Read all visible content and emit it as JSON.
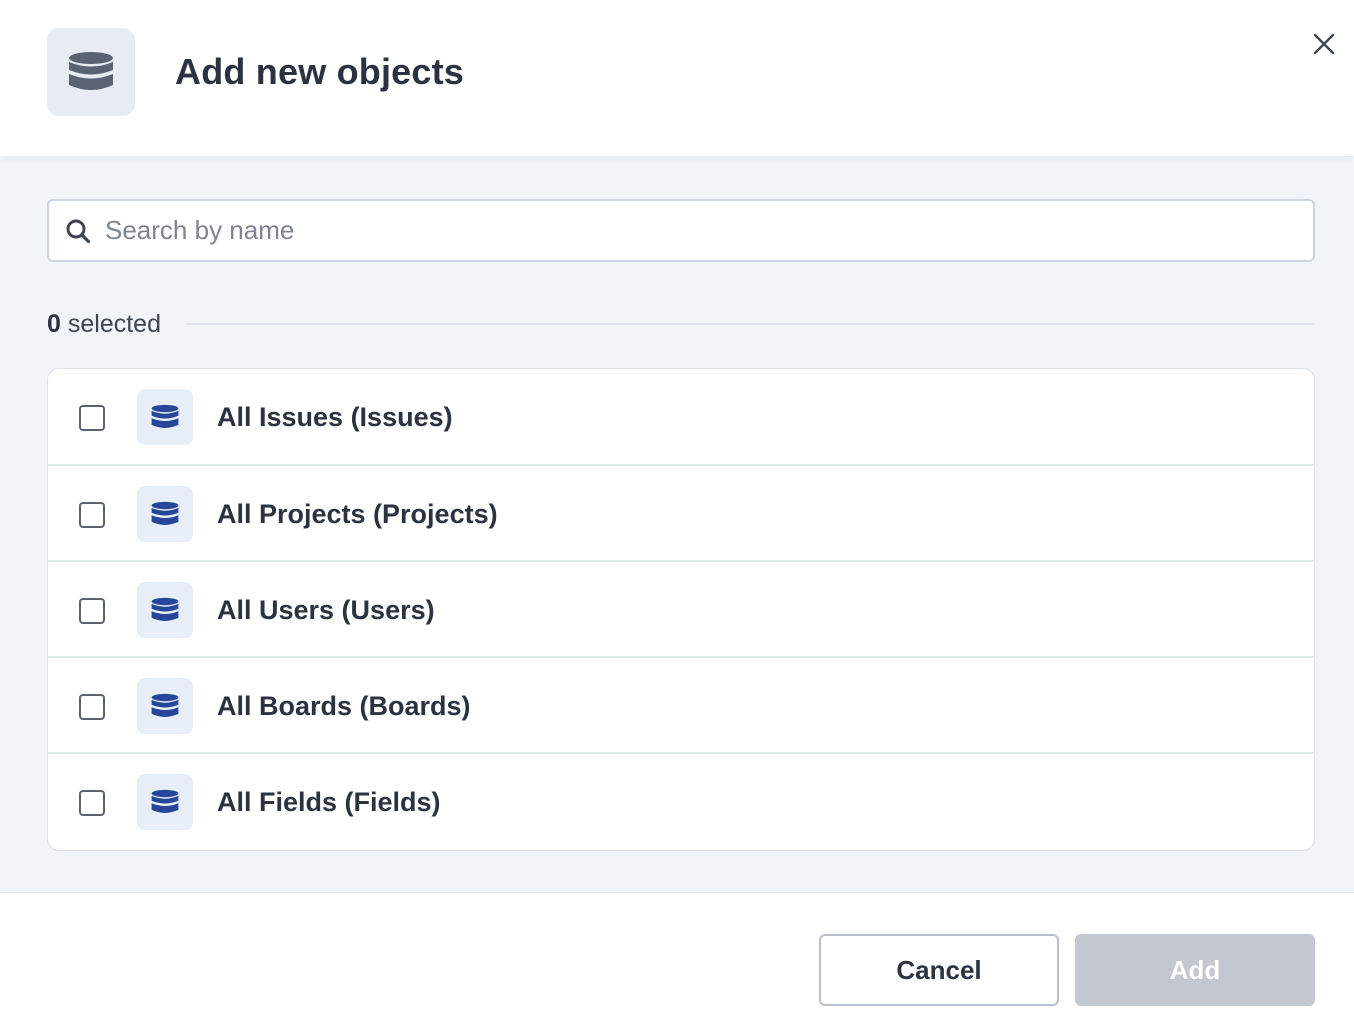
{
  "dialog": {
    "title": "Add new objects",
    "header_icon": "database-icon",
    "close_icon": "close-icon"
  },
  "search": {
    "placeholder": "Search by name",
    "value": "",
    "icon": "search-icon"
  },
  "selection": {
    "count": "0",
    "suffix": "selected"
  },
  "items": [
    {
      "label": "All Issues (Issues)",
      "checked": false,
      "icon": "database-icon"
    },
    {
      "label": "All Projects (Projects)",
      "checked": false,
      "icon": "database-icon"
    },
    {
      "label": "All Users (Users)",
      "checked": false,
      "icon": "database-icon"
    },
    {
      "label": "All Boards (Boards)",
      "checked": false,
      "icon": "database-icon"
    },
    {
      "label": "All Fields (Fields)",
      "checked": false,
      "icon": "database-icon"
    }
  ],
  "footer": {
    "cancel_label": "Cancel",
    "add_label": "Add",
    "add_enabled": false
  },
  "colors": {
    "row_icon": "#27469a",
    "header_icon": "#5b6372",
    "add_disabled_bg": "#c2c7d0",
    "body_bg": "#f1f4f9"
  }
}
